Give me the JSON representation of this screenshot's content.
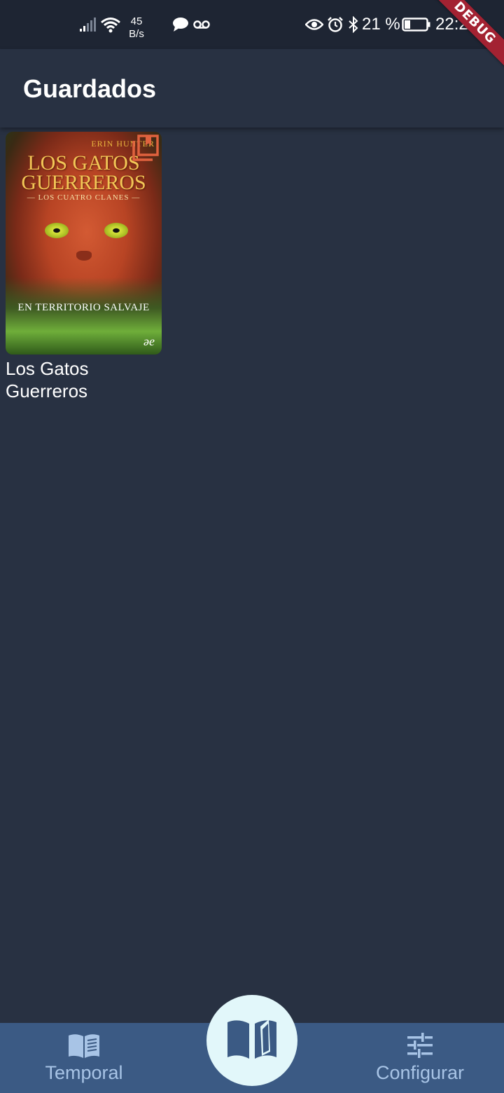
{
  "status_bar": {
    "netspeed_value": "45",
    "netspeed_unit": "B/s",
    "battery": "21 %",
    "time": "22:27"
  },
  "debug_banner": "DEBUG",
  "app_bar": {
    "title": "Guardados"
  },
  "books": [
    {
      "title": "Los Gatos Guerreros",
      "cover": {
        "author": "ERIN HUNTER",
        "title_line1": "LOS GATOS",
        "title_line2": "GUERREROS",
        "subtitle": "— LOS CUATRO CLANES —",
        "volume": "EN TERRITORIO SALVAJE",
        "logo": "ǝe"
      }
    }
  ],
  "bottom_nav": {
    "left_label": "Temporal",
    "right_label": "Configurar",
    "bar_color": "#3b5a84",
    "label_color": "#a8c4e6",
    "fab_color": "#e2f7fa",
    "fab_icon": "open-book-icon"
  },
  "accent": {
    "bookmark": "#e0623e",
    "debug": "#a32232"
  }
}
